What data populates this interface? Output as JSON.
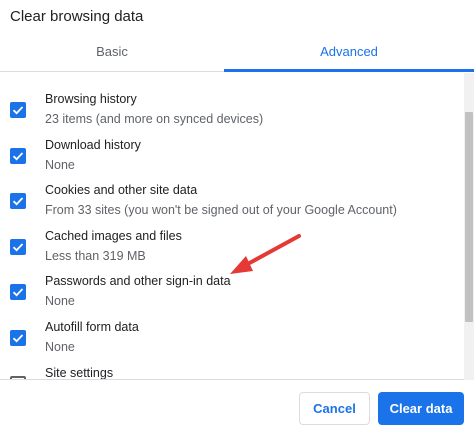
{
  "dialog": {
    "title": "Clear browsing data"
  },
  "tabs": [
    {
      "label": "Basic",
      "selected": false
    },
    {
      "label": "Advanced",
      "selected": true
    }
  ],
  "items": [
    {
      "label": "Browsing history",
      "sub": "23 items (and more on synced devices)",
      "checked": true
    },
    {
      "label": "Download history",
      "sub": "None",
      "checked": true
    },
    {
      "label": "Cookies and other site data",
      "sub": "From 33 sites (you won't be signed out of your Google Account)",
      "checked": true
    },
    {
      "label": "Cached images and files",
      "sub": "Less than 319 MB",
      "checked": true
    },
    {
      "label": "Passwords and other sign-in data",
      "sub": "None",
      "checked": true
    },
    {
      "label": "Autofill form data",
      "sub": "None",
      "checked": true
    },
    {
      "label": "Site settings",
      "sub": "",
      "checked": false
    }
  ],
  "buttons": {
    "cancel": "Cancel",
    "clear": "Clear data"
  },
  "colors": {
    "accent": "#1a73e8",
    "annotation_arrow": "#e53935"
  },
  "icons": {
    "checkbox": "check-icon",
    "annotation": "arrow-icon"
  }
}
